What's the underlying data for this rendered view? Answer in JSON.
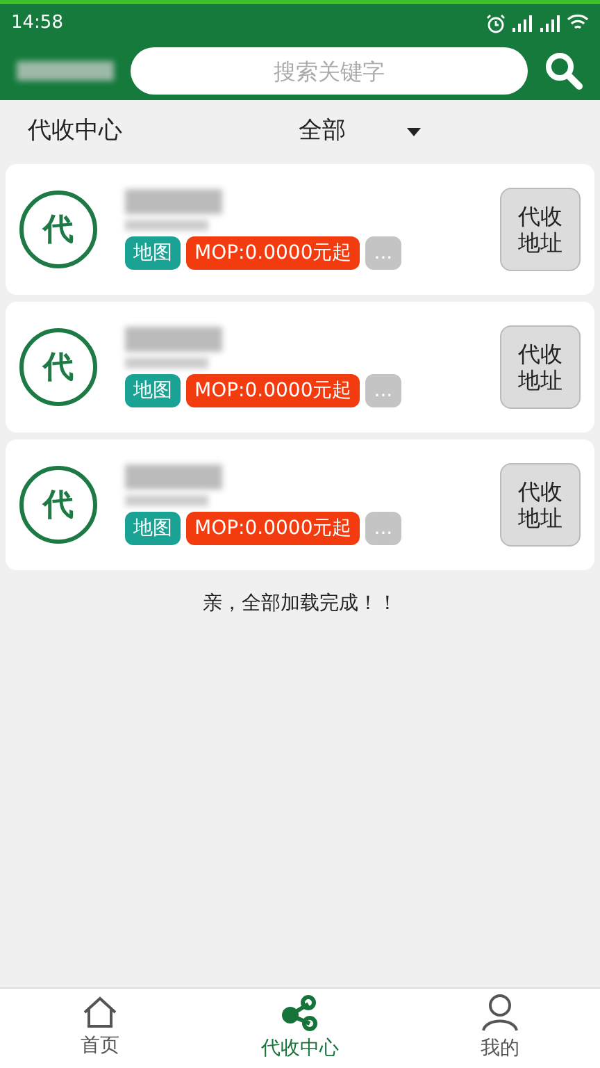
{
  "status_bar": {
    "time": "14:58"
  },
  "header": {
    "search": {
      "placeholder": "搜索关键字"
    }
  },
  "filter": {
    "title": "代收中心",
    "dropdown": "全部"
  },
  "stores": [
    {
      "badge": "代",
      "tags": [
        {
          "kind": "map",
          "label": "地图"
        },
        {
          "kind": "price",
          "label": "MOP:0.0000元起"
        },
        {
          "kind": "more",
          "label": "..."
        }
      ],
      "button": "代收地址"
    },
    {
      "badge": "代",
      "tags": [
        {
          "kind": "map",
          "label": "地图"
        },
        {
          "kind": "price",
          "label": "MOP:0.0000元起"
        },
        {
          "kind": "more",
          "label": "..."
        }
      ],
      "button": "代收地址"
    },
    {
      "badge": "代",
      "tags": [
        {
          "kind": "map",
          "label": "地图"
        },
        {
          "kind": "price",
          "label": "MOP:0.0000元起"
        },
        {
          "kind": "more",
          "label": "..."
        }
      ],
      "button": "代收地址"
    }
  ],
  "footer_note": "亲，全部加载完成！！",
  "nav": [
    {
      "kind": "home",
      "label": "首页",
      "selected": false
    },
    {
      "kind": "share",
      "label": "代收中心",
      "selected": true
    },
    {
      "kind": "user",
      "label": "我的",
      "selected": false
    }
  ]
}
